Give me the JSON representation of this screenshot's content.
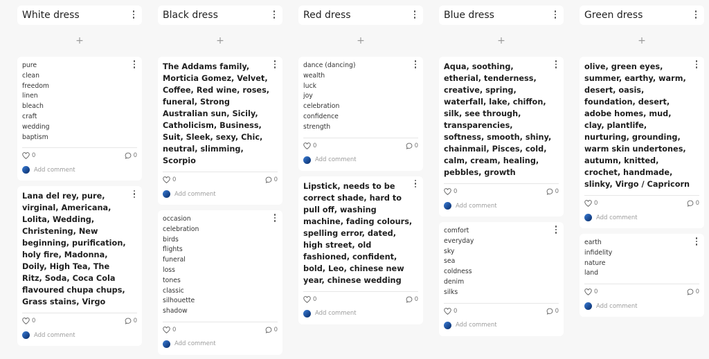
{
  "icons": {
    "kebab": "more-vertical-icon",
    "add": "plus-icon",
    "like": "heart-icon",
    "comment": "speech-bubble-icon",
    "avatar": "user-avatar"
  },
  "colors": {
    "background": "#f7f7f7",
    "card": "#ffffff",
    "avatar": "#1d4f9a"
  },
  "add_symbol": "+",
  "add_comment_label": "Add comment",
  "columns": [
    {
      "title": "White dress",
      "cards": [
        {
          "text": "pure\nclean\nfreedom\nlinen\nbleach\ncraft\nwedding\nbaptism",
          "likes": "0",
          "comments": "0"
        },
        {
          "text": "Lana del rey, pure, virginal, Americana, Lolita, Wedding, Christening, New beginning, purification, holy fire, Madonna, Doily, High Tea, The Ritz, Soda, Coca Cola flavoured chupa chups, Grass stains, Virgo",
          "likes": "0",
          "comments": "0"
        }
      ]
    },
    {
      "title": "Black dress",
      "cards": [
        {
          "text": "The Addams family, Morticia Gomez, Velvet, Coffee, Red wine, roses, funeral, Strong Australian sun, Sicily, Catholicism, Business, Suit, Sleek, sexy, Chic, neutral, slimming, Scorpio",
          "likes": "0",
          "comments": "0"
        },
        {
          "text": "occasion\ncelebration\nbirds\nflights\nfuneral\nloss\ntones\nclassic\nsilhouette\nshadow",
          "likes": "0",
          "comments": "0"
        }
      ]
    },
    {
      "title": "Red dress",
      "cards": [
        {
          "text": "dance (dancing)\nwealth\nluck\njoy\ncelebration\nconfidence\nstrength",
          "likes": "0",
          "comments": "0"
        },
        {
          "text": "Lipstick, needs to be correct shade, hard to pull off, washing machine, fading colours, spelling error, dated, high street, old fashioned, confident, bold, Leo, chinese new year, chinese wedding",
          "likes": "0",
          "comments": "0"
        }
      ]
    },
    {
      "title": "Blue dress",
      "cards": [
        {
          "text": "Aqua, soothing, etherial, tenderness, creative, spring, waterfall, lake, chiffon, silk, see through, transparencies, softness, smooth, shiny, chainmail, Pisces, cold, calm, cream, healing, pebbles, growth",
          "likes": "0",
          "comments": "0"
        },
        {
          "text": "comfort\neveryday\nsky\nsea\ncoldness\ndenim\nsilks",
          "likes": "0",
          "comments": "0"
        }
      ]
    },
    {
      "title": "Green dress",
      "cards": [
        {
          "text": "olive, green eyes, summer, earthy, warm, desert, oasis, foundation, desert, adobe homes, mud, clay, plantlife, nurturing, grounding, warm skin undertones, autumn, knitted, crochet, handmade, slinky, Virgo / Capricorn",
          "likes": "0",
          "comments": "0"
        },
        {
          "text": "earth\ninfidelity\nnature\nland",
          "likes": "0",
          "comments": "0"
        }
      ]
    }
  ]
}
